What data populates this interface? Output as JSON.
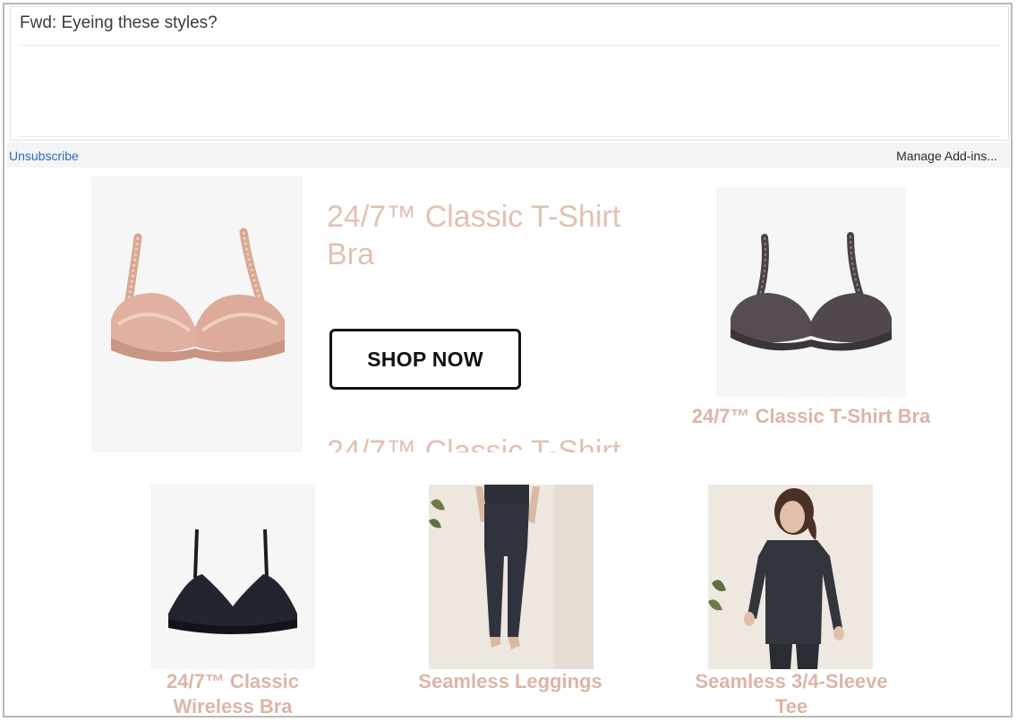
{
  "email": {
    "subject": "Fwd: Eyeing these styles?",
    "unsubscribe_label": "Unsubscribe",
    "manage_addins_label": "Manage Add-ins..."
  },
  "hero": {
    "title": "24/7™ Classic T-Shirt Bra",
    "cta_label": "SHOP NOW",
    "repeated_title": "24/7™ Classic T-Shirt"
  },
  "products": [
    {
      "name": "24/7™ Classic T-Shirt Bra",
      "image": "bra-charcoal"
    },
    {
      "name": "24/7™ Classic Wireless Bra",
      "image": "bralette-black"
    },
    {
      "name": "Seamless Leggings",
      "image": "model-leggings"
    },
    {
      "name": "Seamless 3/4-Sleeve Tee",
      "image": "model-tee"
    }
  ],
  "colors": {
    "accent_pink": "#dcb5a6",
    "link_blue": "#2b6cc4",
    "button_border": "#111111"
  }
}
